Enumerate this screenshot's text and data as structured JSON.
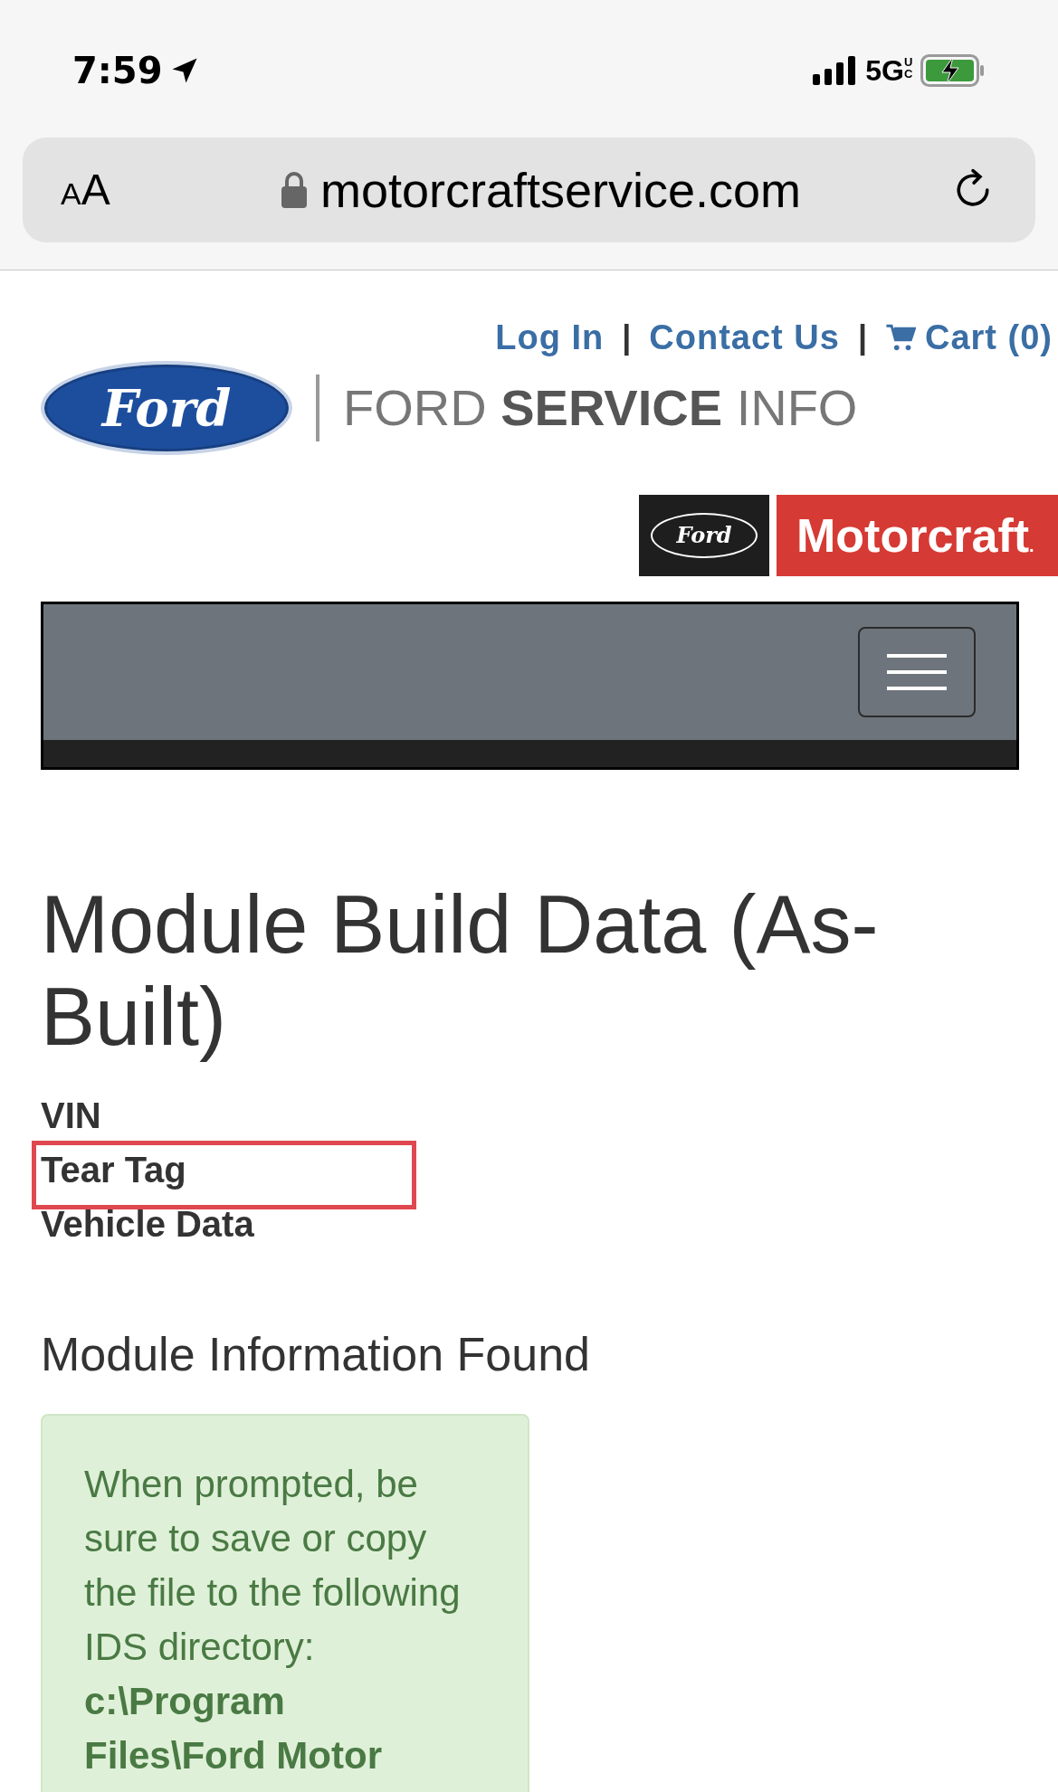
{
  "status_bar": {
    "time": "7:59",
    "network": "5G",
    "network_suffix": "UC"
  },
  "address_bar": {
    "text_size_button": "AA",
    "url": "motorcraftservice.com"
  },
  "top_links": [
    {
      "kind": "link",
      "label": "Log In"
    },
    {
      "kind": "separator",
      "label": "|"
    },
    {
      "kind": "link",
      "label": "Contact Us"
    },
    {
      "kind": "separator",
      "label": "|"
    },
    {
      "kind": "cart",
      "label": "Cart (0)"
    }
  ],
  "logo": {
    "oval_text": "Ford",
    "light_1": "FORD ",
    "bold": "SERVICE",
    "light_2": "INFO"
  },
  "badge": {
    "oval_text": "Ford",
    "brand": "Motorcraft",
    "mark": "."
  },
  "page_title": "Module Build Data (As-Built)",
  "options": [
    {
      "label": "VIN",
      "highlighted": false
    },
    {
      "label": "Tear Tag",
      "highlighted": true
    },
    {
      "label": "Vehicle Data",
      "highlighted": false
    }
  ],
  "section_title": "Module Information Found",
  "notice": "When prompted, be sure to save or copy the file to the following IDS directory: **c:\\Program Files\\Ford Motor**"
}
